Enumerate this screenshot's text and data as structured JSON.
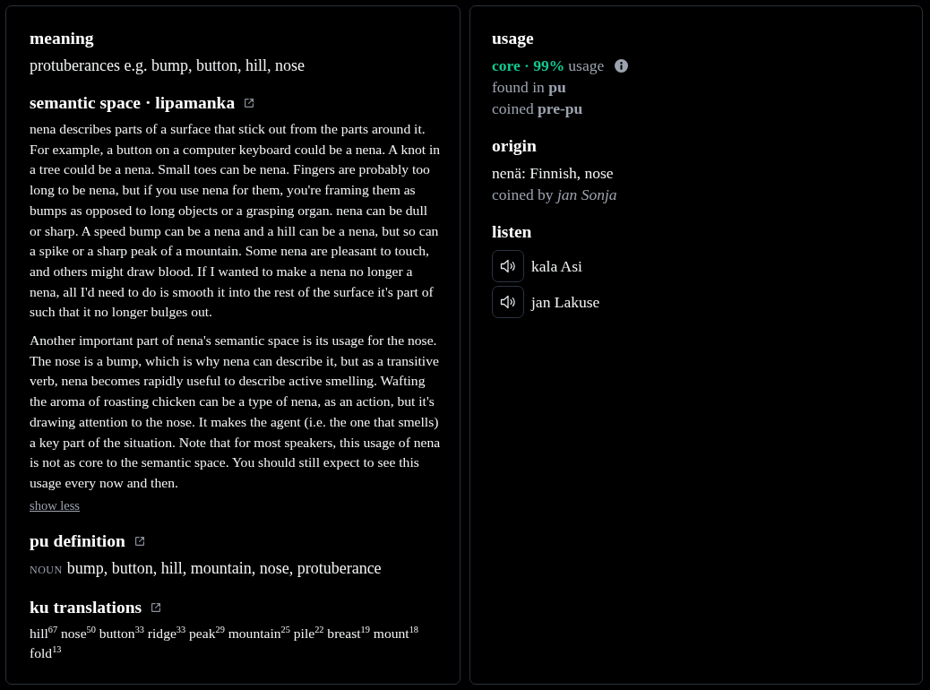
{
  "meaning": {
    "heading": "meaning",
    "text": "protuberances e.g. bump, button, hill, nose"
  },
  "semantic_space": {
    "heading": "semantic space · lipamanka",
    "paragraphs": [
      "nena describes parts of a surface that stick out from the parts around it. For example, a button on a computer keyboard could be a nena. A knot in a tree could be a nena. Small toes can be nena. Fingers are probably too long to be nena, but if you use nena for them, you're framing them as bumps as opposed to long objects or a grasping organ. nena can be dull or sharp. A speed bump can be a nena and a hill can be a nena, but so can a spike or a sharp peak of a mountain. Some nena are pleasant to touch, and others might draw blood. If I wanted to make a nena no longer a nena, all I'd need to do is smooth it into the rest of the surface it's part of such that it no longer bulges out.",
      "Another important part of nena's semantic space is its usage for the nose. The nose is a bump, which is why nena can describe it, but as a transitive verb, nena becomes rapidly useful to describe active smelling. Wafting the aroma of roasting chicken can be a type of nena, as an action, but it's drawing attention to the nose. It makes the agent (i.e. the one that smells) a key part of the situation. Note that for most speakers, this usage of nena is not as core to the semantic space. You should still expect to see this usage every now and then."
    ],
    "toggle_link": "show less"
  },
  "pu_definition": {
    "heading": "pu definition",
    "part_of_speech": "NOUN",
    "text": "bump, button, hill, mountain, nose, protuberance"
  },
  "ku_translations": {
    "heading": "ku translations",
    "items": [
      "hill$^{67}$",
      "nose$^{50}$",
      "button$^{33}$",
      "ridge$^{33}$",
      "peak$^{29}$",
      "mountain$^{25}$",
      "pile$^{22}$",
      "breast$^{19}$",
      "mount$^{18}$",
      "fold$^{13}$"
    ]
  },
  "usage": {
    "heading": "usage",
    "category": "core · 99%",
    "label": "usage",
    "found_in": "found in **pu**",
    "coined": "coined **pre-pu**"
  },
  "origin": {
    "heading": "origin",
    "etymology": "nenä: Finnish, nose",
    "coined_by": "coined by *jan Sonja*"
  },
  "listen": {
    "heading": "listen",
    "recordings": [
      {
        "speaker": "kala Asi"
      },
      {
        "speaker": "jan Lakuse"
      }
    ]
  }
}
